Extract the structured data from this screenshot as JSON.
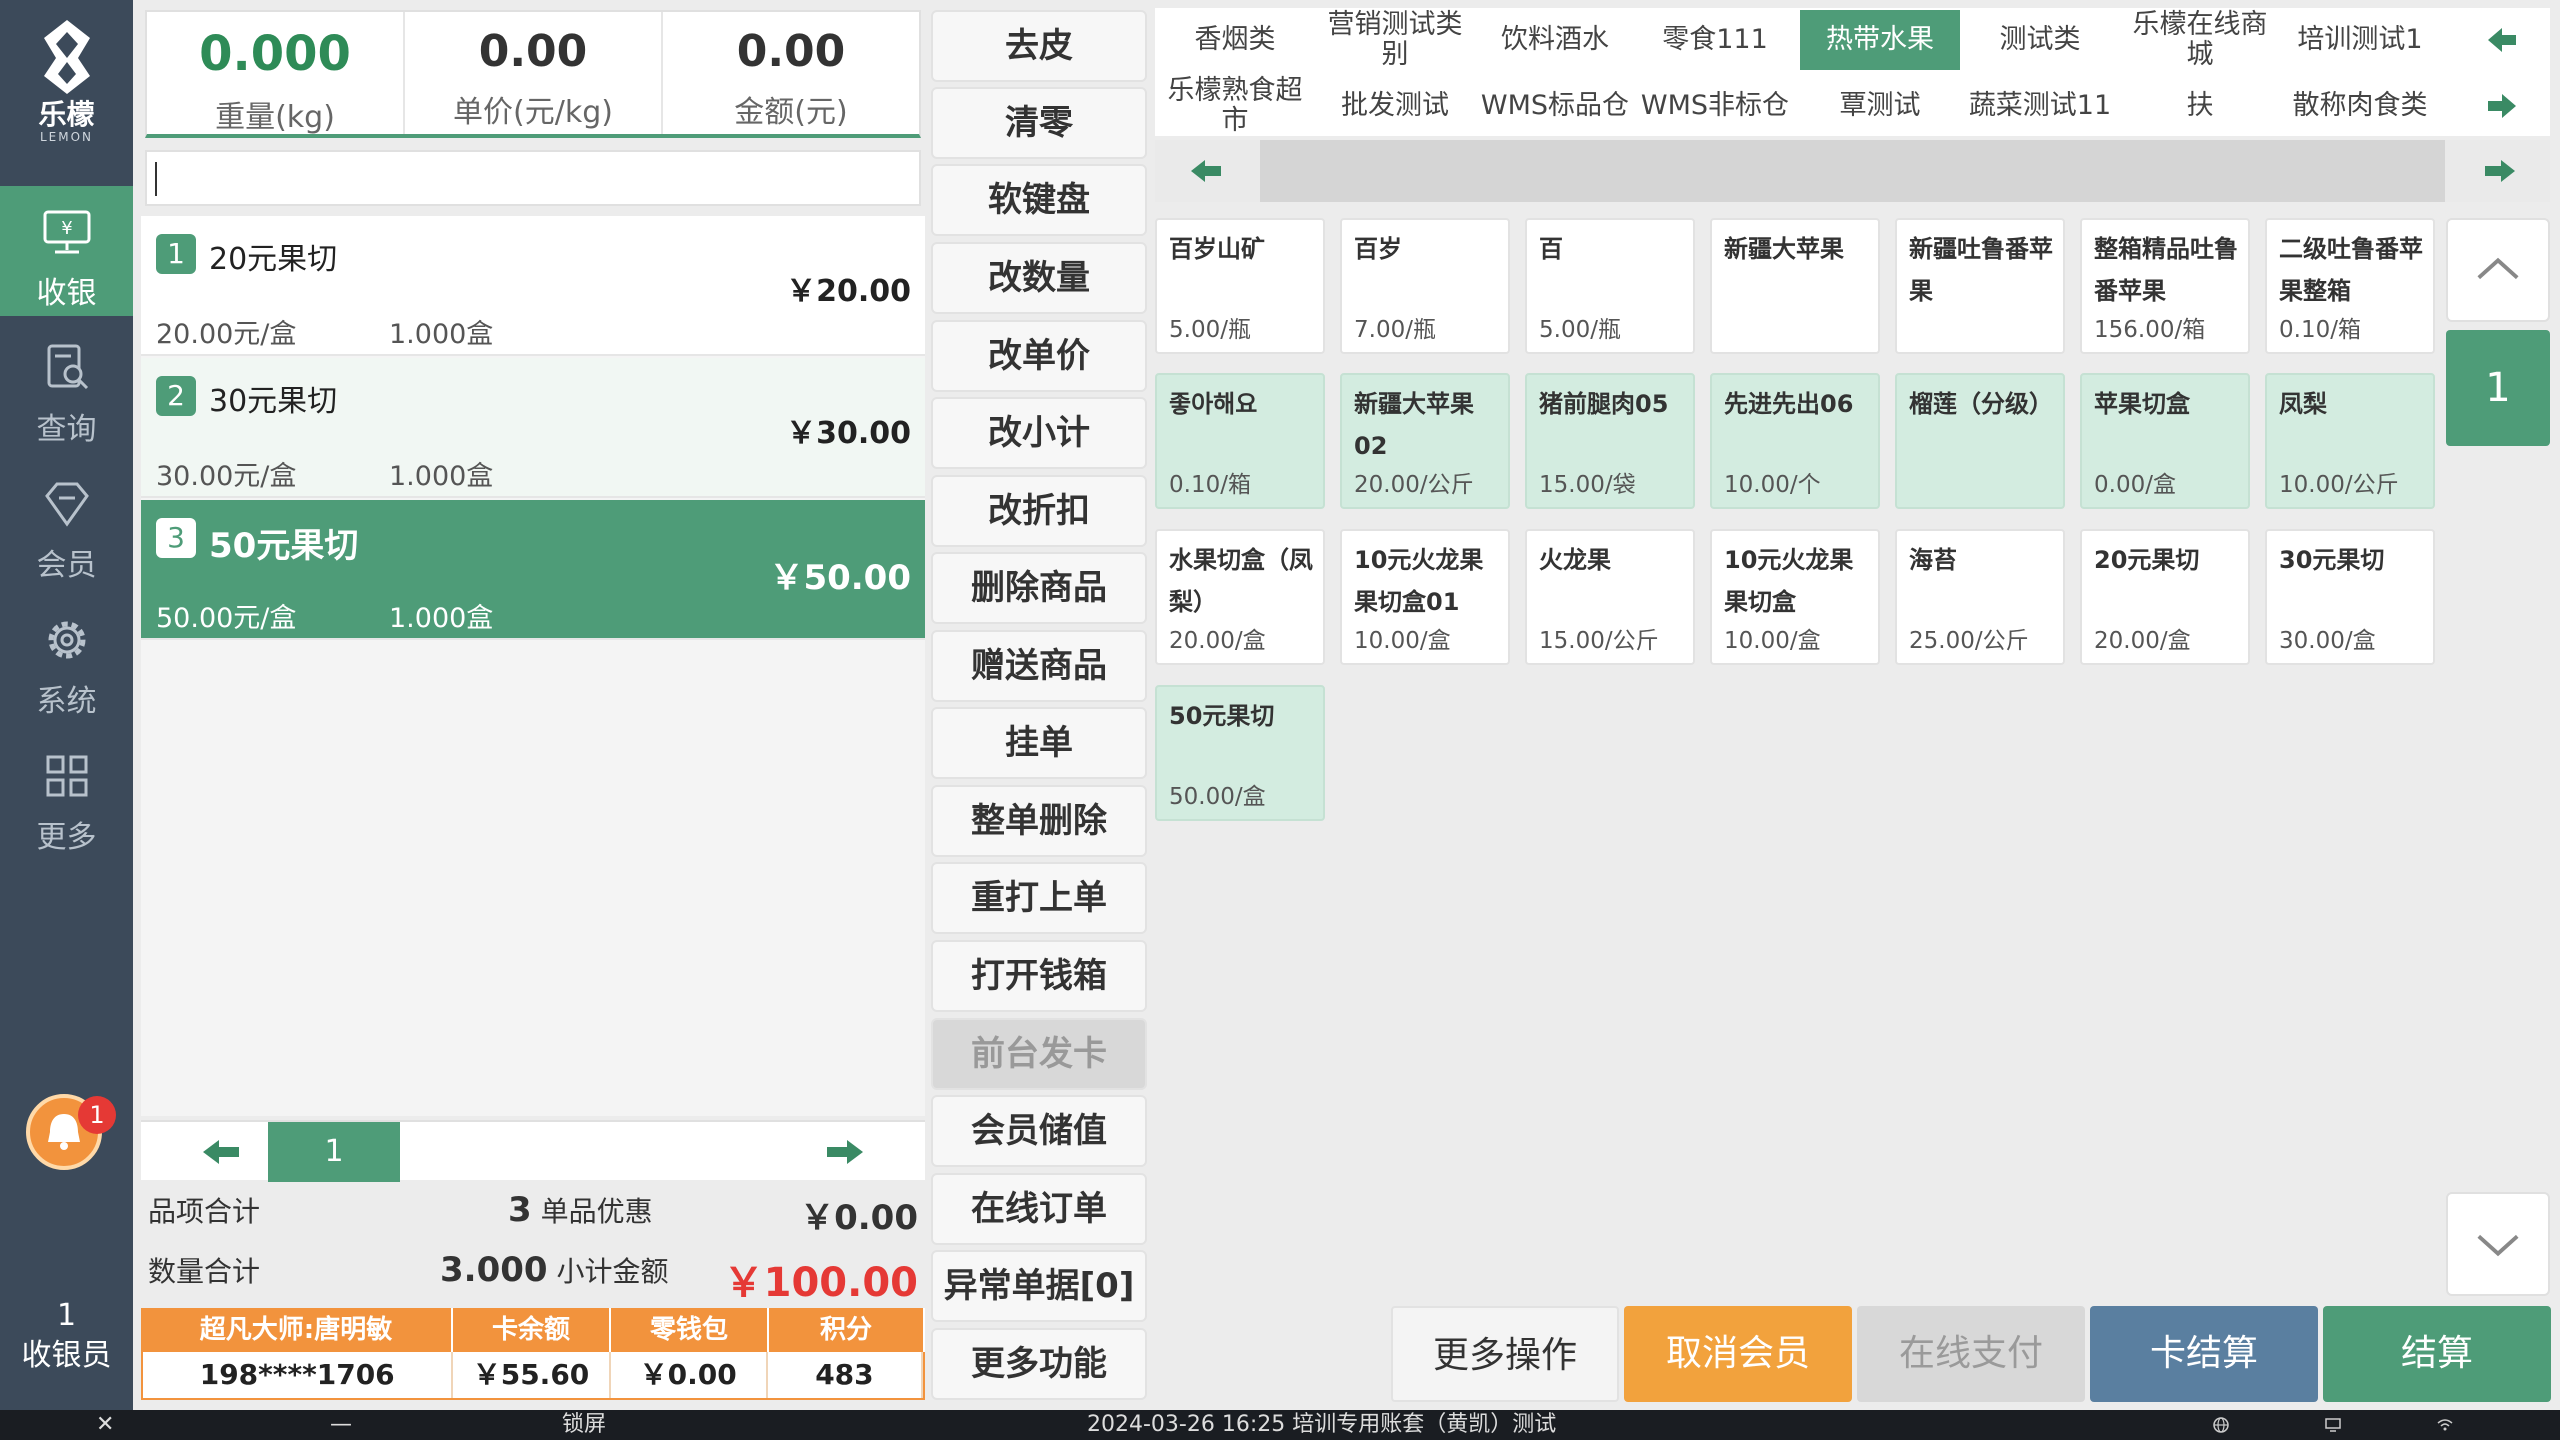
{
  "brand": {
    "name": "乐檬",
    "sub": "LEMON"
  },
  "nav": [
    {
      "label": "收银",
      "icon": "cashier-icon",
      "active": true
    },
    {
      "label": "查询",
      "icon": "search-doc-icon"
    },
    {
      "label": "会员",
      "icon": "diamond-icon"
    },
    {
      "label": "系统",
      "icon": "gear-icon"
    },
    {
      "label": "更多",
      "icon": "grid-icon"
    }
  ],
  "notifications": {
    "count": "1"
  },
  "cashier": {
    "id": "1",
    "label": "收银员"
  },
  "display": {
    "weight": {
      "value": "0.000",
      "label": "重量(kg)"
    },
    "unit_price": {
      "value": "0.00",
      "label": "单价(元/kg)"
    },
    "amount": {
      "value": "0.00",
      "label": "金额(元)"
    }
  },
  "cart": {
    "items": [
      {
        "idx": "1",
        "name": "20元果切",
        "price": "￥20.00",
        "unit_price": "20.00元/盒",
        "qty": "1.000盒"
      },
      {
        "idx": "2",
        "name": "30元果切",
        "price": "￥30.00",
        "unit_price": "30.00元/盒",
        "qty": "1.000盒"
      },
      {
        "idx": "3",
        "name": "50元果切",
        "price": "￥50.00",
        "unit_price": "50.00元/盒",
        "qty": "1.000盒"
      }
    ],
    "page": "1"
  },
  "summary": {
    "item_total_label": "品项合计",
    "item_total": "3",
    "discount_label": "单品优惠",
    "discount": "￥0.00",
    "qty_total_label": "数量合计",
    "qty_total": "3.000",
    "subtotal_label": "小计金额",
    "subtotal": "￥100.00"
  },
  "member": {
    "headers": [
      "超凡大师:唐明敏",
      "卡余额",
      "零钱包",
      "积分"
    ],
    "values": [
      "198****1706",
      "￥55.60",
      "￥0.00",
      "483"
    ]
  },
  "functions": [
    "去皮",
    "清零",
    "软键盘",
    "改数量",
    "改单价",
    "改小计",
    "改折扣",
    "删除商品",
    "赠送商品",
    "挂单",
    "整单删除",
    "重打上单",
    "打开钱箱",
    "前台发卡",
    "会员储值",
    "在线订单",
    "异常单据[0]",
    "更多功能"
  ],
  "categories": {
    "row1": [
      "香烟类",
      "营销测试类别",
      "饮料酒水",
      "零食111",
      "热带水果",
      "测试类",
      "乐檬在线商城",
      "培训测试1"
    ],
    "row2": [
      "乐檬熟食超市",
      "批发测试",
      "WMS标品仓",
      "WMS非标仓",
      "覃测试",
      "蔬菜测试11",
      "扶",
      "散称肉食类"
    ],
    "active": "热带水果"
  },
  "products": [
    {
      "name": "百岁山矿",
      "price": "5.00/瓶",
      "green": false
    },
    {
      "name": "百岁",
      "price": "7.00/瓶",
      "green": false
    },
    {
      "name": "百",
      "price": "5.00/瓶",
      "green": false
    },
    {
      "name": "新疆大苹果",
      "price": "",
      "green": false
    },
    {
      "name": "新疆吐鲁番苹果",
      "price": "",
      "green": false
    },
    {
      "name": "整箱精品吐鲁番苹果",
      "price": "156.00/箱",
      "green": false
    },
    {
      "name": "二级吐鲁番苹果整箱",
      "price": "0.10/箱",
      "green": false
    },
    {
      "name": "좋아해요",
      "price": "0.10/箱",
      "green": true
    },
    {
      "name": "新疆大苹果02",
      "price": "20.00/公斤",
      "green": true
    },
    {
      "name": "猪前腿肉05",
      "price": "15.00/袋",
      "green": true
    },
    {
      "name": "先进先出06",
      "price": "10.00/个",
      "green": true
    },
    {
      "name": "榴莲（分级）",
      "price": "",
      "green": true
    },
    {
      "name": "苹果切盒",
      "price": "0.00/盒",
      "green": true
    },
    {
      "name": "凤梨",
      "price": "10.00/公斤",
      "green": true
    },
    {
      "name": "水果切盒（凤梨）",
      "price": "20.00/盒",
      "green": false
    },
    {
      "name": "10元火龙果果切盒01",
      "price": "10.00/盒",
      "green": false
    },
    {
      "name": "火龙果",
      "price": "15.00/公斤",
      "green": false
    },
    {
      "name": "10元火龙果果切盒",
      "price": "10.00/盒",
      "green": false
    },
    {
      "name": "海苔",
      "price": "25.00/公斤",
      "green": false
    },
    {
      "name": "20元果切",
      "price": "20.00/盒",
      "green": false
    },
    {
      "name": "30元果切",
      "price": "30.00/盒",
      "green": false
    },
    {
      "name": "50元果切",
      "price": "50.00/盒",
      "green": true
    }
  ],
  "product_page": "1",
  "actions": {
    "more": "更多操作",
    "cancel_member": "取消会员",
    "online_pay": "在线支付",
    "card_settle": "卡结算",
    "settle": "结算"
  },
  "taskbar": {
    "close": "✕",
    "minimize": "—",
    "lock": "锁屏",
    "info": "2024-03-26 16:25 培训专用账套（黄凯）测试"
  },
  "colors": {
    "accent": "#4e9c78",
    "sidebar": "#3c4a5a",
    "orange": "#f2933d",
    "red": "#e53935",
    "blue": "#5a7fa0"
  }
}
